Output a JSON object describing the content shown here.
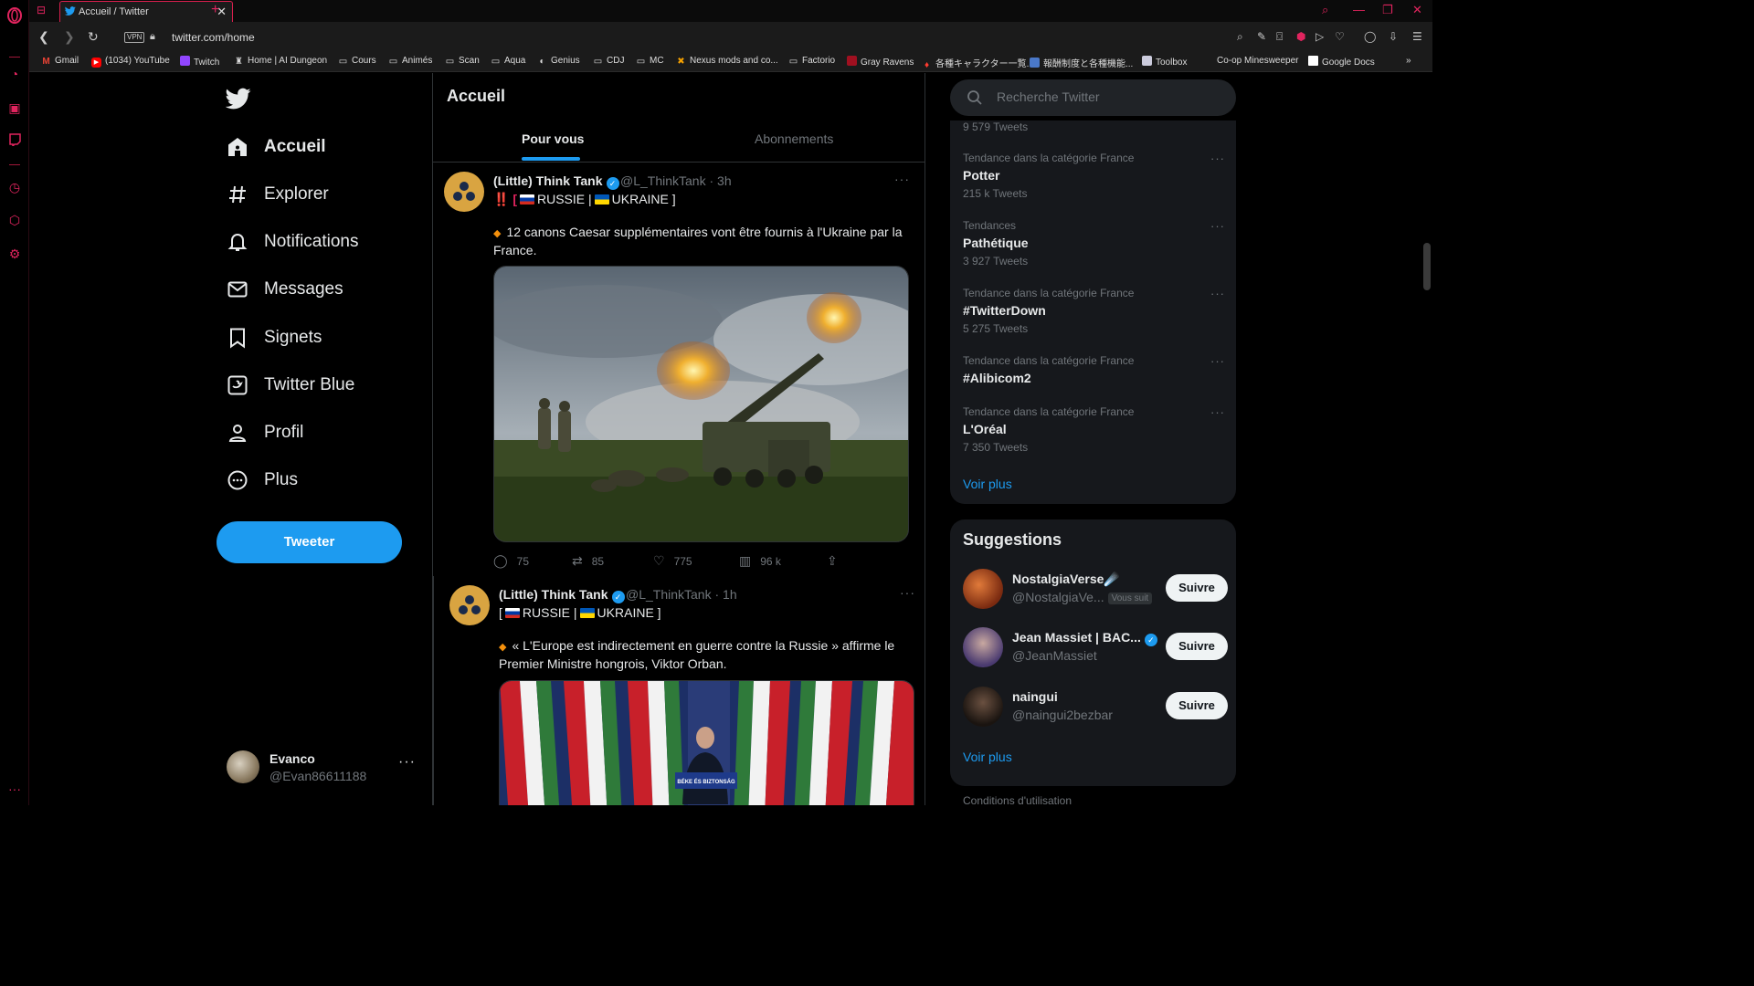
{
  "browser": {
    "tab_title": "Accueil / Twitter",
    "url": "twitter.com/home",
    "vpn_label": "VPN",
    "accent": "#e0245e",
    "bookmarks": [
      {
        "label": "Gmail",
        "icon": "gmail-icon"
      },
      {
        "label": "(1034) YouTube",
        "icon": "youtube-icon"
      },
      {
        "label": "Twitch",
        "icon": "twitch-icon"
      },
      {
        "label": "Home | AI Dungeon",
        "icon": "ai-dungeon-icon"
      },
      {
        "label": "Cours",
        "icon": "folder-icon"
      },
      {
        "label": "Animés",
        "icon": "folder-icon"
      },
      {
        "label": "Scan",
        "icon": "folder-icon"
      },
      {
        "label": "Aqua",
        "icon": "folder-icon"
      },
      {
        "label": "Genius",
        "icon": "genius-icon"
      },
      {
        "label": "CDJ",
        "icon": "folder-icon"
      },
      {
        "label": "MC",
        "icon": "folder-icon"
      },
      {
        "label": "Nexus mods and co...",
        "icon": "nexus-icon"
      },
      {
        "label": "Factorio",
        "icon": "folder-icon"
      },
      {
        "label": "Gray Ravens",
        "icon": "gray-ravens-icon"
      },
      {
        "label": "各種キャラクター一覧...",
        "icon": "fire-icon"
      },
      {
        "label": "報酬制度と各種機能...",
        "icon": "image-icon"
      },
      {
        "label": "Toolbox",
        "icon": "toolbox-icon"
      },
      {
        "label": "Co-op Minesweeper",
        "icon": ""
      },
      {
        "label": "Google Docs",
        "icon": "docs-icon"
      }
    ]
  },
  "nav": {
    "items": [
      {
        "label": "Accueil",
        "icon": "home-icon"
      },
      {
        "label": "Explorer",
        "icon": "hashtag-icon"
      },
      {
        "label": "Notifications",
        "icon": "bell-icon"
      },
      {
        "label": "Messages",
        "icon": "envelope-icon"
      },
      {
        "label": "Signets",
        "icon": "bookmark-icon"
      },
      {
        "label": "Twitter Blue",
        "icon": "twitter-blue-icon"
      },
      {
        "label": "Profil",
        "icon": "person-icon"
      },
      {
        "label": "Plus",
        "icon": "more-circle-icon"
      }
    ],
    "tweet_button": "Tweeter",
    "account": {
      "name": "Evanco",
      "handle": "@Evan86611188"
    }
  },
  "timeline": {
    "title": "Accueil",
    "tab_for_you": "Pour vous",
    "tab_following": "Abonnements",
    "tweets": [
      {
        "name": "(Little) Think Tank",
        "handle": "@L_ThinkTank · 3h",
        "headline_prefix": "‼️ [",
        "headline_ru": "RUSSIE |",
        "headline_ua": "UKRAINE ]",
        "body": "12 canons Caesar supplémentaires vont être fournis à l'Ukraine par la France.",
        "stats": {
          "replies": "75",
          "retweets": "85",
          "likes": "775",
          "views": "96 k"
        }
      },
      {
        "name": "(Little) Think Tank",
        "handle": "@L_ThinkTank · 1h",
        "headline_prefix": "[",
        "headline_ru": "RUSSIE |",
        "headline_ua": "UKRAINE ]",
        "body": "« L'Europe est indirectement en guerre contre la Russie » affirme le Premier Ministre hongrois, Viktor Orban.",
        "image_caption": "BÉKE ÉS BIZTONSÁG"
      }
    ]
  },
  "sidebar": {
    "search_placeholder": "Recherche Twitter",
    "top_count": "9 579 Tweets",
    "trends": [
      {
        "category": "Tendance dans la catégorie France",
        "title": "Potter",
        "count": "215 k Tweets"
      },
      {
        "category": "Tendances",
        "title": "Pathétique",
        "count": "3 927 Tweets"
      },
      {
        "category": "Tendance dans la catégorie France",
        "title": "#TwitterDown",
        "count": "5 275 Tweets"
      },
      {
        "category": "Tendance dans la catégorie France",
        "title": "#Alibicom2",
        "count": ""
      },
      {
        "category": "Tendance dans la catégorie France",
        "title": "L'Oréal",
        "count": "7 350 Tweets"
      }
    ],
    "show_more": "Voir plus",
    "suggestions_title": "Suggestions",
    "suggestions": [
      {
        "name": "NostalgiaVerse☄️",
        "handle": "@NostalgiaVe...",
        "badge": "Vous suit",
        "verified": false
      },
      {
        "name": "Jean Massiet | BAC...",
        "handle": "@JeanMassiet",
        "badge": "",
        "verified": true
      },
      {
        "name": "naingui",
        "handle": "@naingui2bezbar",
        "badge": "",
        "verified": false
      }
    ],
    "follow_label": "Suivre",
    "show_more_2": "Voir plus",
    "terms": "Conditions d'utilisation"
  }
}
